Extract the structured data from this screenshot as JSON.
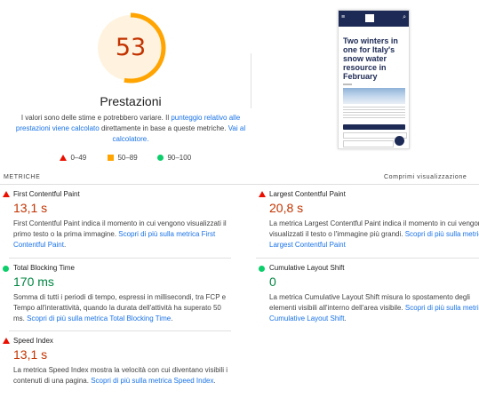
{
  "performance": {
    "score": "53",
    "title": "Prestazioni",
    "desc_pre": "I valori sono delle stime e potrebbero variare. Il ",
    "desc_link1": "punteggio relativo alle prestazioni viene calcolato",
    "desc_mid": " direttamente in base a queste metriche. ",
    "desc_link2": "Vai al calcolatore.",
    "score_color": "#ffa400",
    "score_fraction": 0.53
  },
  "legend": {
    "fail": "0–49",
    "average": "50–89",
    "pass": "90–100"
  },
  "preview": {
    "headline": "Two winters in one for Italy's snow water resource in February"
  },
  "metrics_section": {
    "label": "METRICHE",
    "collapse_label": "Comprimi visualizzazione"
  },
  "metrics": [
    {
      "name": "First Contentful Paint",
      "value": "13,1 s",
      "rating": "fail",
      "desc": "First Contentful Paint indica il momento in cui vengono visualizzati il primo testo o la prima immagine. ",
      "link": "Scopri di più sulla metrica First Contentful Paint",
      "tail": "."
    },
    {
      "name": "Largest Contentful Paint",
      "value": "20,8 s",
      "rating": "fail",
      "desc": "La metrica Largest Contentful Paint indica il momento in cui vengono visualizzati il testo o l'immagine più grandi. ",
      "link": "Scopri di più sulla metrica Largest Contentful Paint",
      "tail": ""
    },
    {
      "name": "Total Blocking Time",
      "value": "170 ms",
      "rating": "pass",
      "desc": "Somma di tutti i periodi di tempo, espressi in millisecondi, tra FCP e Tempo all'interattività, quando la durata dell'attività ha superato 50 ms. ",
      "link": "Scopri di più sulla metrica Total Blocking Time",
      "tail": "."
    },
    {
      "name": "Cumulative Layout Shift",
      "value": "0",
      "rating": "pass",
      "desc": "La metrica Cumulative Layout Shift misura lo spostamento degli elementi visibili all'interno dell'area visibile. ",
      "link": "Scopri di più sulla metrica Cumulative Layout Shift",
      "tail": "."
    },
    {
      "name": "Speed Index",
      "value": "13,1 s",
      "rating": "fail",
      "desc": "La metrica Speed Index mostra la velocità con cui diventano visibili i contenuti di una pagina. ",
      "link": "Scopri di più sulla metrica Speed Index",
      "tail": "."
    }
  ]
}
